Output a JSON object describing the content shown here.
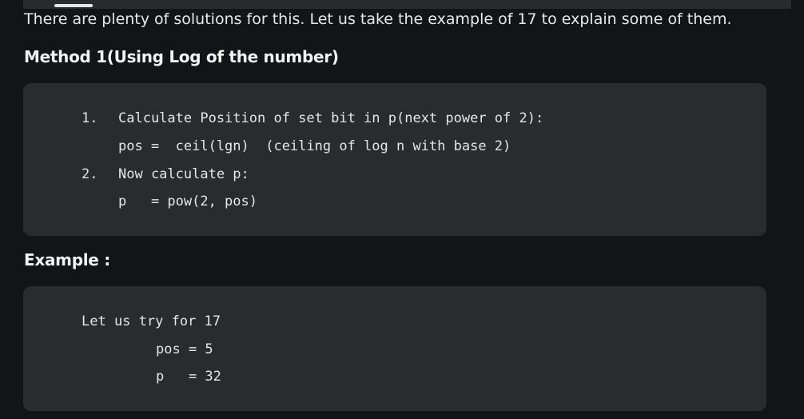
{
  "intro_text": "There are plenty of solutions for this. Let us take the example of 17 to explain some of them.",
  "method_heading": "Method 1(Using Log of the number)",
  "method_code": {
    "step1_num": "1.",
    "step1_text": "Calculate Position of set bit in p(next power of 2):",
    "step1_sub": "pos =  ceil(lgn)  (ceiling of log n with base 2)",
    "step2_num": "2.",
    "step2_text": "Now calculate p:",
    "step2_sub": "p   = pow(2, pos)"
  },
  "example_heading": "Example :",
  "example_code": {
    "line1": "Let us try for 17",
    "line2": "pos = 5",
    "line3": "p   = 32"
  }
}
